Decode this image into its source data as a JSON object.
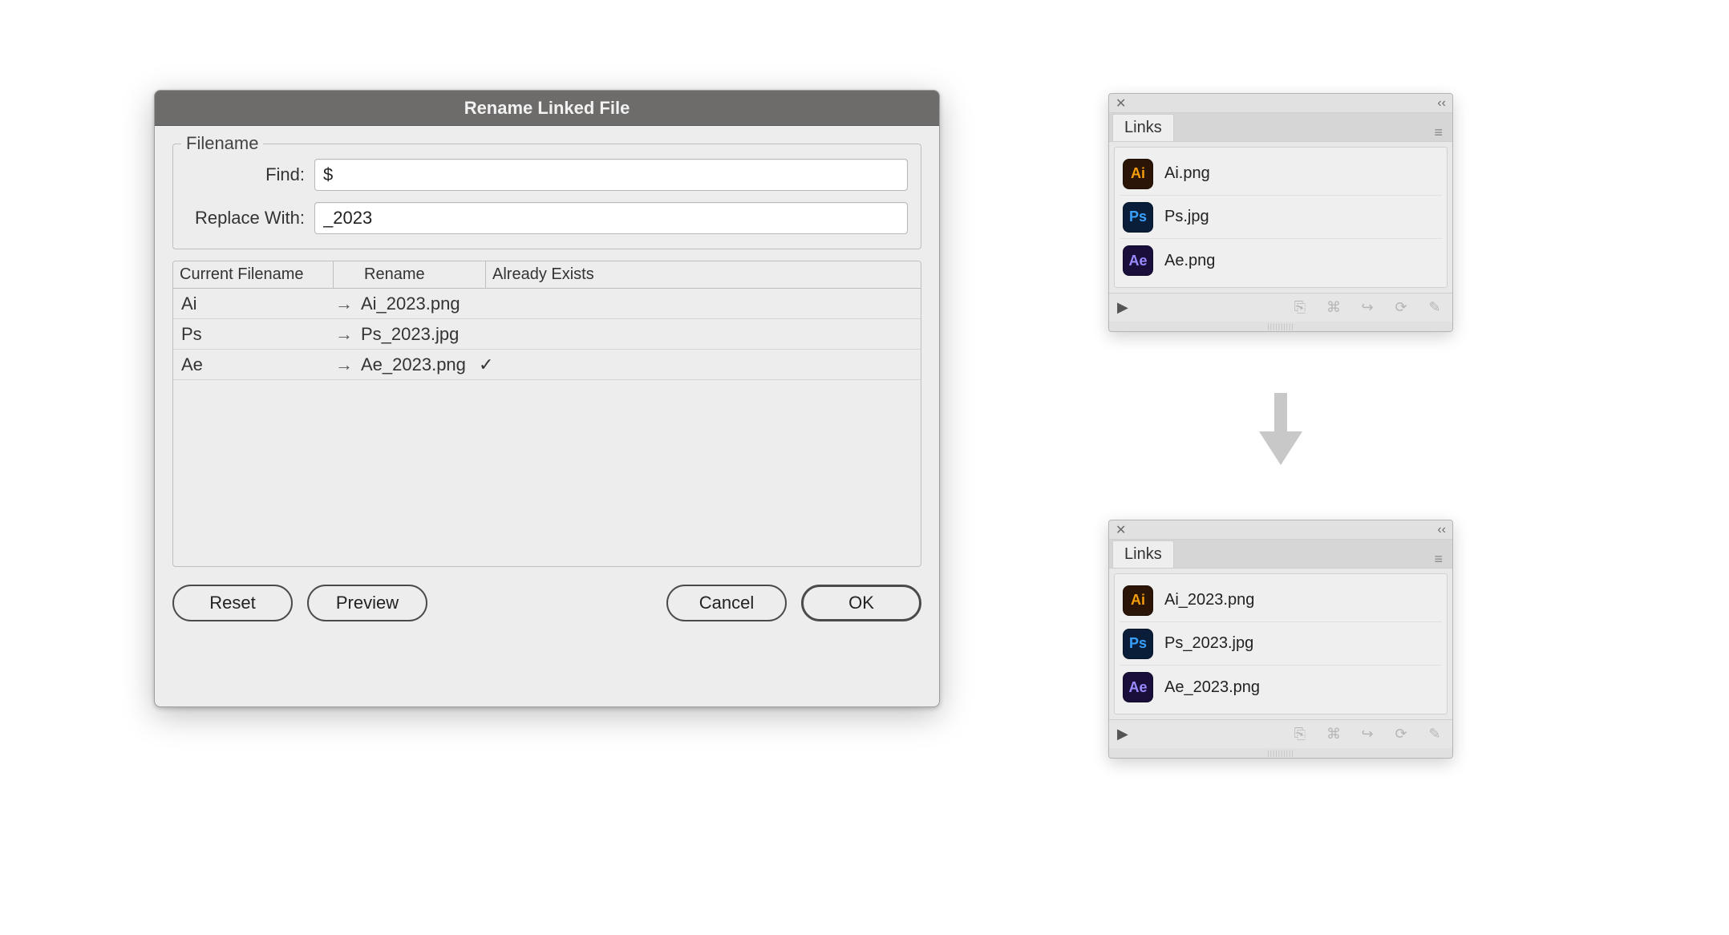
{
  "dialog": {
    "title": "Rename Linked File",
    "fieldset_label": "Filename",
    "find_label": "Find:",
    "find_value": "$",
    "replace_label": "Replace With:",
    "replace_value": "_2023",
    "columns": {
      "current": "Current Filename",
      "rename": "Rename",
      "exists": "Already Exists"
    },
    "rows": [
      {
        "current": "Ai",
        "rename": "Ai_2023.png",
        "exists": false
      },
      {
        "current": "Ps",
        "rename": "Ps_2023.jpg",
        "exists": false
      },
      {
        "current": "Ae",
        "rename": "Ae_2023.png",
        "exists": true
      }
    ],
    "buttons": {
      "reset": "Reset",
      "preview": "Preview",
      "cancel": "Cancel",
      "ok": "OK"
    }
  },
  "links_panel": {
    "tab_label": "Links",
    "close_glyph": "✕",
    "collapse_glyph": "‹‹",
    "menu_glyph": "≡"
  },
  "links_before": [
    {
      "icon": "ai",
      "label": "Ai",
      "name": "Ai.png"
    },
    {
      "icon": "ps",
      "label": "Ps",
      "name": "Ps.jpg"
    },
    {
      "icon": "ae",
      "label": "Ae",
      "name": "Ae.png"
    }
  ],
  "links_after": [
    {
      "icon": "ai",
      "label": "Ai",
      "name": "Ai_2023.png"
    },
    {
      "icon": "ps",
      "label": "Ps",
      "name": "Ps_2023.jpg"
    },
    {
      "icon": "ae",
      "label": "Ae",
      "name": "Ae_2023.png"
    }
  ]
}
